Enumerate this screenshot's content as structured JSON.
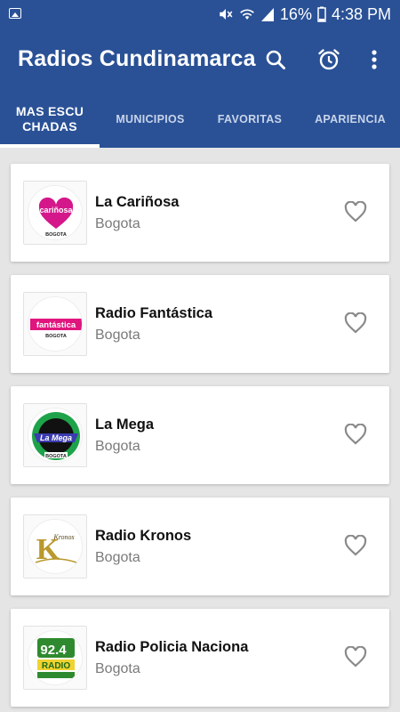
{
  "status_bar": {
    "battery": "16%",
    "time": "4:38 PM"
  },
  "app_bar": {
    "title": "Radios Cundinamarca"
  },
  "tabs": [
    {
      "label": "MAS ESCU CHADAS",
      "active": true
    },
    {
      "label": "MUNICIPIOS",
      "active": false
    },
    {
      "label": "FAVORITAS",
      "active": false
    },
    {
      "label": "APARIENCIA",
      "active": false
    }
  ],
  "stations": [
    {
      "name": "La Cariñosa",
      "city": "Bogota",
      "logo_text": "cariñosa",
      "logo_sub": "BOGOTA",
      "logo_color": "#d4178a"
    },
    {
      "name": "Radio Fantástica",
      "city": "Bogota",
      "logo_text": "fantástica",
      "logo_sub": "BOGOTA",
      "logo_color": "#e0157d"
    },
    {
      "name": "La Mega",
      "city": "Bogota",
      "logo_text": "La Mega",
      "logo_sub": "BOGOTA",
      "logo_color": "#3b3bb0"
    },
    {
      "name": "Radio Kronos",
      "city": "Bogota",
      "logo_text": "Kronos",
      "logo_sub": "",
      "logo_color": "#b9982c"
    },
    {
      "name": "Radio Policia Naciona",
      "city": "Bogota",
      "logo_text": "92.4",
      "logo_sub": "RADIO",
      "logo_color": "#2f8a2f"
    }
  ],
  "colors": {
    "primary": "#2a5196",
    "background": "#e5e5e5",
    "heart_outline": "#8a8a8a"
  }
}
